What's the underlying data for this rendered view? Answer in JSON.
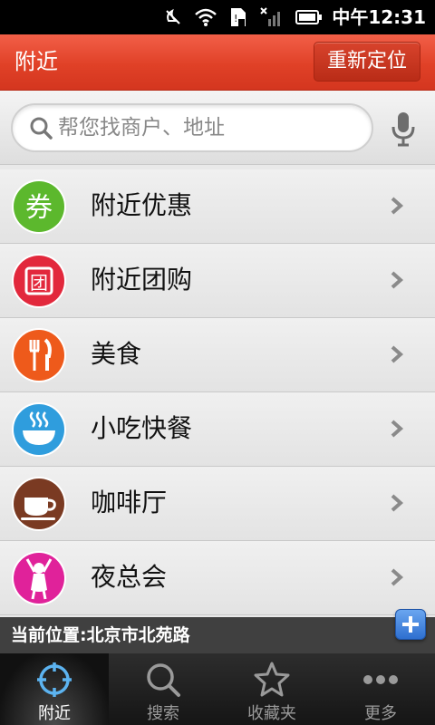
{
  "status_bar": {
    "time": "中午12:31"
  },
  "header": {
    "title": "附近",
    "relocate_label": "重新定位"
  },
  "search": {
    "placeholder": "帮您找商户、地址"
  },
  "categories": [
    {
      "label": "附近优惠",
      "icon": "coupon-icon",
      "icon_text": "券",
      "color": "#5cb82d"
    },
    {
      "label": "附近团购",
      "icon": "group-buy-icon",
      "icon_text": "团",
      "color": "#e2283c"
    },
    {
      "label": "美食",
      "icon": "fork-knife-icon",
      "color": "#ee5a1b"
    },
    {
      "label": "小吃快餐",
      "icon": "bowl-icon",
      "color": "#2f9ddd"
    },
    {
      "label": "咖啡厅",
      "icon": "coffee-cup-icon",
      "color": "#7a3a22"
    },
    {
      "label": "夜总会",
      "icon": "dancer-icon",
      "color": "#e0229a"
    }
  ],
  "location": {
    "text": "当前位置:北京市北苑路"
  },
  "tabs": [
    {
      "label": "附近",
      "icon": "crosshair-icon",
      "active": true
    },
    {
      "label": "搜索",
      "icon": "search-icon",
      "active": false
    },
    {
      "label": "收藏夹",
      "icon": "star-icon",
      "active": false
    },
    {
      "label": "更多",
      "icon": "more-dots-icon",
      "active": false
    }
  ]
}
